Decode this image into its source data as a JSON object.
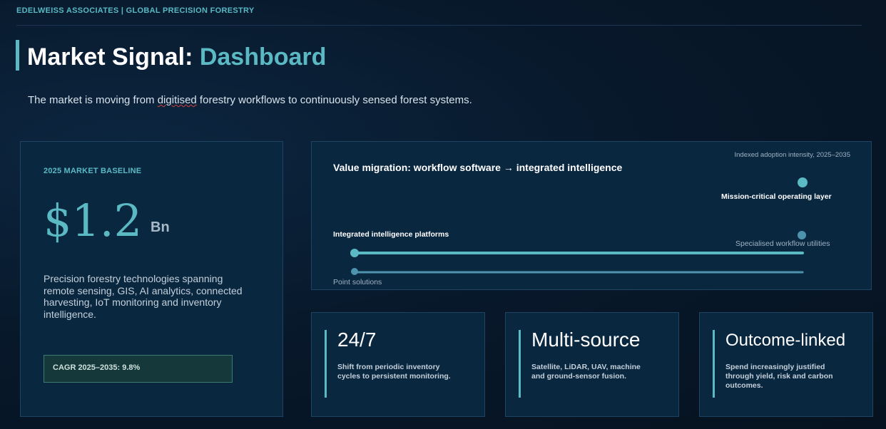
{
  "header": {
    "brand": "EDELWEISS ASSOCIATES | GLOBAL PRECISION FORESTRY",
    "title_main": "Market Signal: ",
    "title_accent": "Dashboard",
    "subtitle_pre": "The market is moving from ",
    "subtitle_flag": "digitised",
    "subtitle_post": " forestry workflows to continuously sensed forest systems."
  },
  "baseline": {
    "label": "2025 MARKET BASELINE",
    "value": "$1.2",
    "unit": "Bn",
    "description": "Precision forestry technologies spanning remote sensing, GIS, AI analytics, connected harvesting, IoT monitoring and inventory intelligence.",
    "cagr": "CAGR 2025–2035: 9.8%"
  },
  "migration": {
    "title": "Value migration: workflow software → integrated intelligence",
    "note": "Indexed adoption intensity, 2025–2035",
    "layers": [
      {
        "label": "Mission-critical operating layer"
      },
      {
        "label": "Integrated intelligence platforms"
      },
      {
        "label": "Specialised workflow utilities"
      },
      {
        "label": "Point solutions"
      }
    ],
    "colors": {
      "accent": "#5ab9c3",
      "muted": "#4d93ad"
    }
  },
  "stats": [
    {
      "headline": "24/7",
      "description": "Shift from periodic inventory cycles to persistent monitoring."
    },
    {
      "headline": "Multi-source",
      "description": "Satellite, LiDAR, UAV, machine and ground-sensor fusion."
    },
    {
      "headline": "Outcome-linked",
      "description": "Spend increasingly justified through yield, risk and carbon outcomes."
    }
  ]
}
